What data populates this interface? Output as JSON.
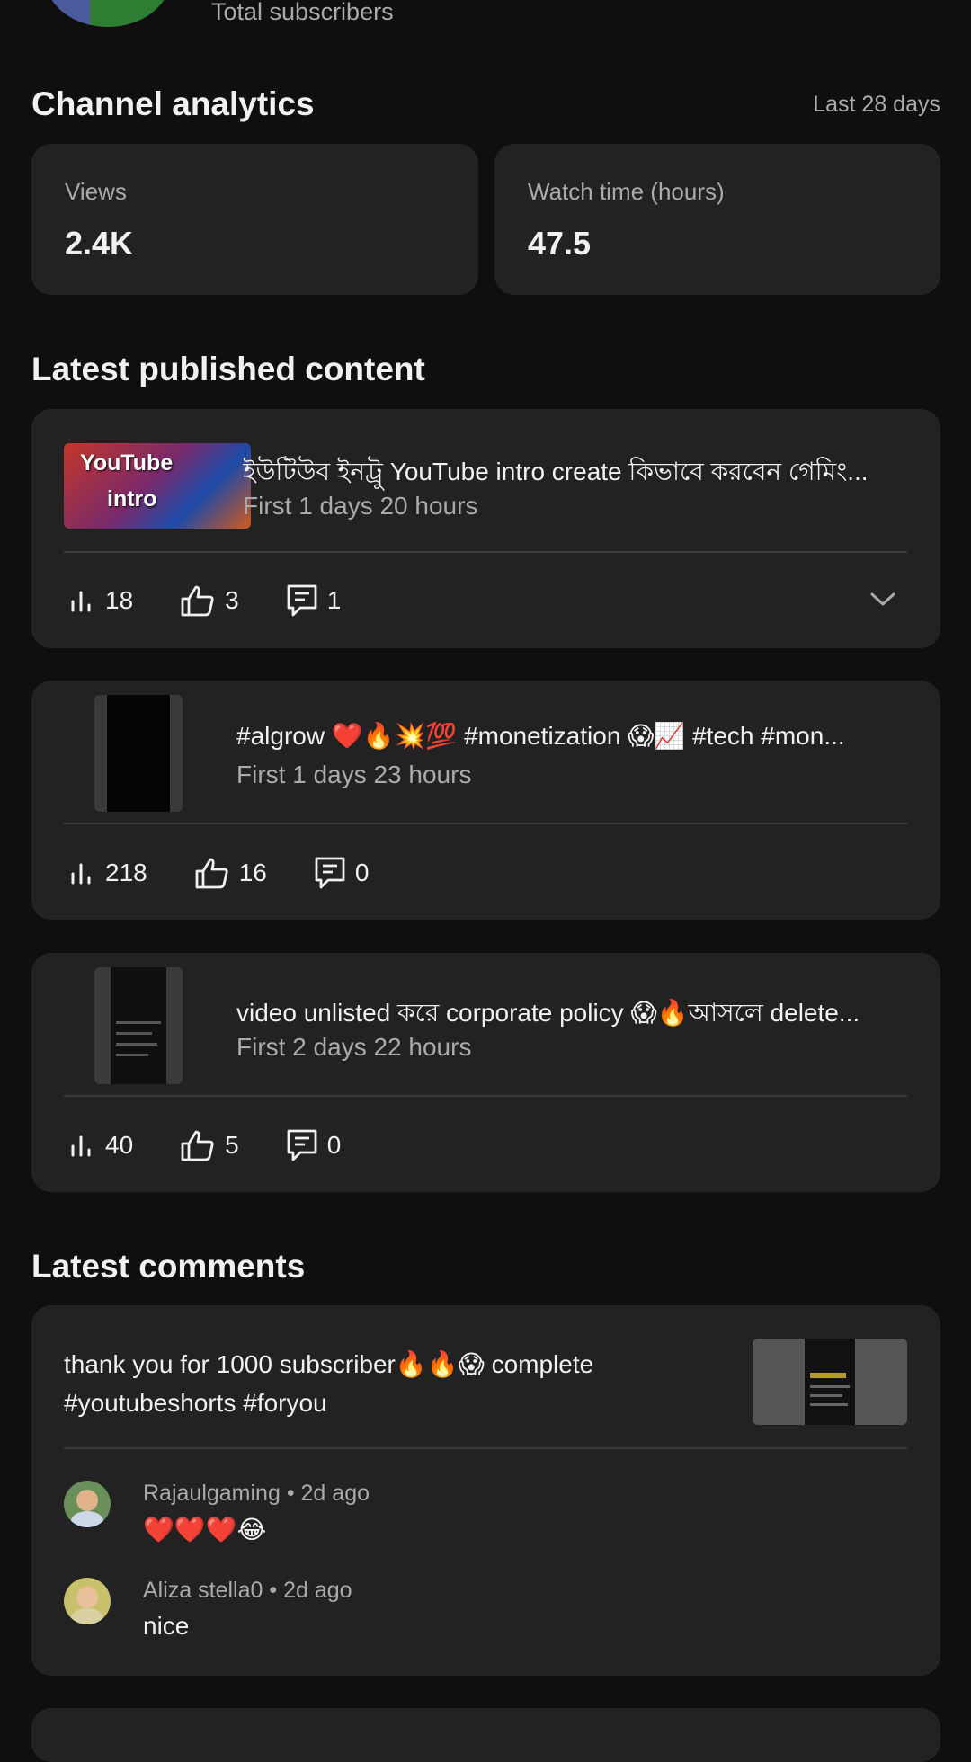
{
  "header": {
    "subscribers_label": "Total subscribers"
  },
  "analytics": {
    "title": "Channel analytics",
    "period": "Last 28 days",
    "views_label": "Views",
    "views_value": "2.4K",
    "watch_label": "Watch time (hours)",
    "watch_value": "47.5"
  },
  "latest": {
    "title": "Latest published content",
    "items": [
      {
        "title": "ইউটিউব ইনট্রু YouTube intro create কিভাবে করবেন গেমিং...",
        "sub": "First 1 days 20 hours",
        "views": "18",
        "likes": "3",
        "comments": "1",
        "thumb_text_1": "YouTube",
        "thumb_text_2": "intro"
      },
      {
        "title": "#algrow ❤️🔥💥💯 #monetization 😱📈 #tech #mon...",
        "sub": "First 1 days 23 hours",
        "views": "218",
        "likes": "16",
        "comments": "0"
      },
      {
        "title": "video unlisted করে corporate policy 😱🔥আসলে delete...",
        "sub": "First 2 days 22 hours",
        "views": "40",
        "likes": "5",
        "comments": "0"
      }
    ]
  },
  "comments": {
    "title": "Latest comments",
    "video_text": "thank you for 1000 subscriber🔥🔥😱 complete #youtubeshorts #foryou",
    "video_line1": "thank you for 1000 subscriber🔥🔥😱 complete",
    "video_line2": "#youtubeshorts #foryou",
    "list": [
      {
        "author": "Rajaulgaming",
        "time": "2d ago",
        "text": "❤️❤️❤️😂"
      },
      {
        "author": "Aliza stella0",
        "time": "2d ago",
        "text": "nice"
      }
    ]
  },
  "icons": {
    "views": "bar-chart-icon",
    "likes": "thumbs-up-icon",
    "comments": "comment-icon",
    "expand": "chevron-down-icon"
  },
  "colors": {
    "background": "#0f0f0f",
    "card": "#222222",
    "text": "#f1f1f1",
    "muted": "#aaaaaa"
  }
}
